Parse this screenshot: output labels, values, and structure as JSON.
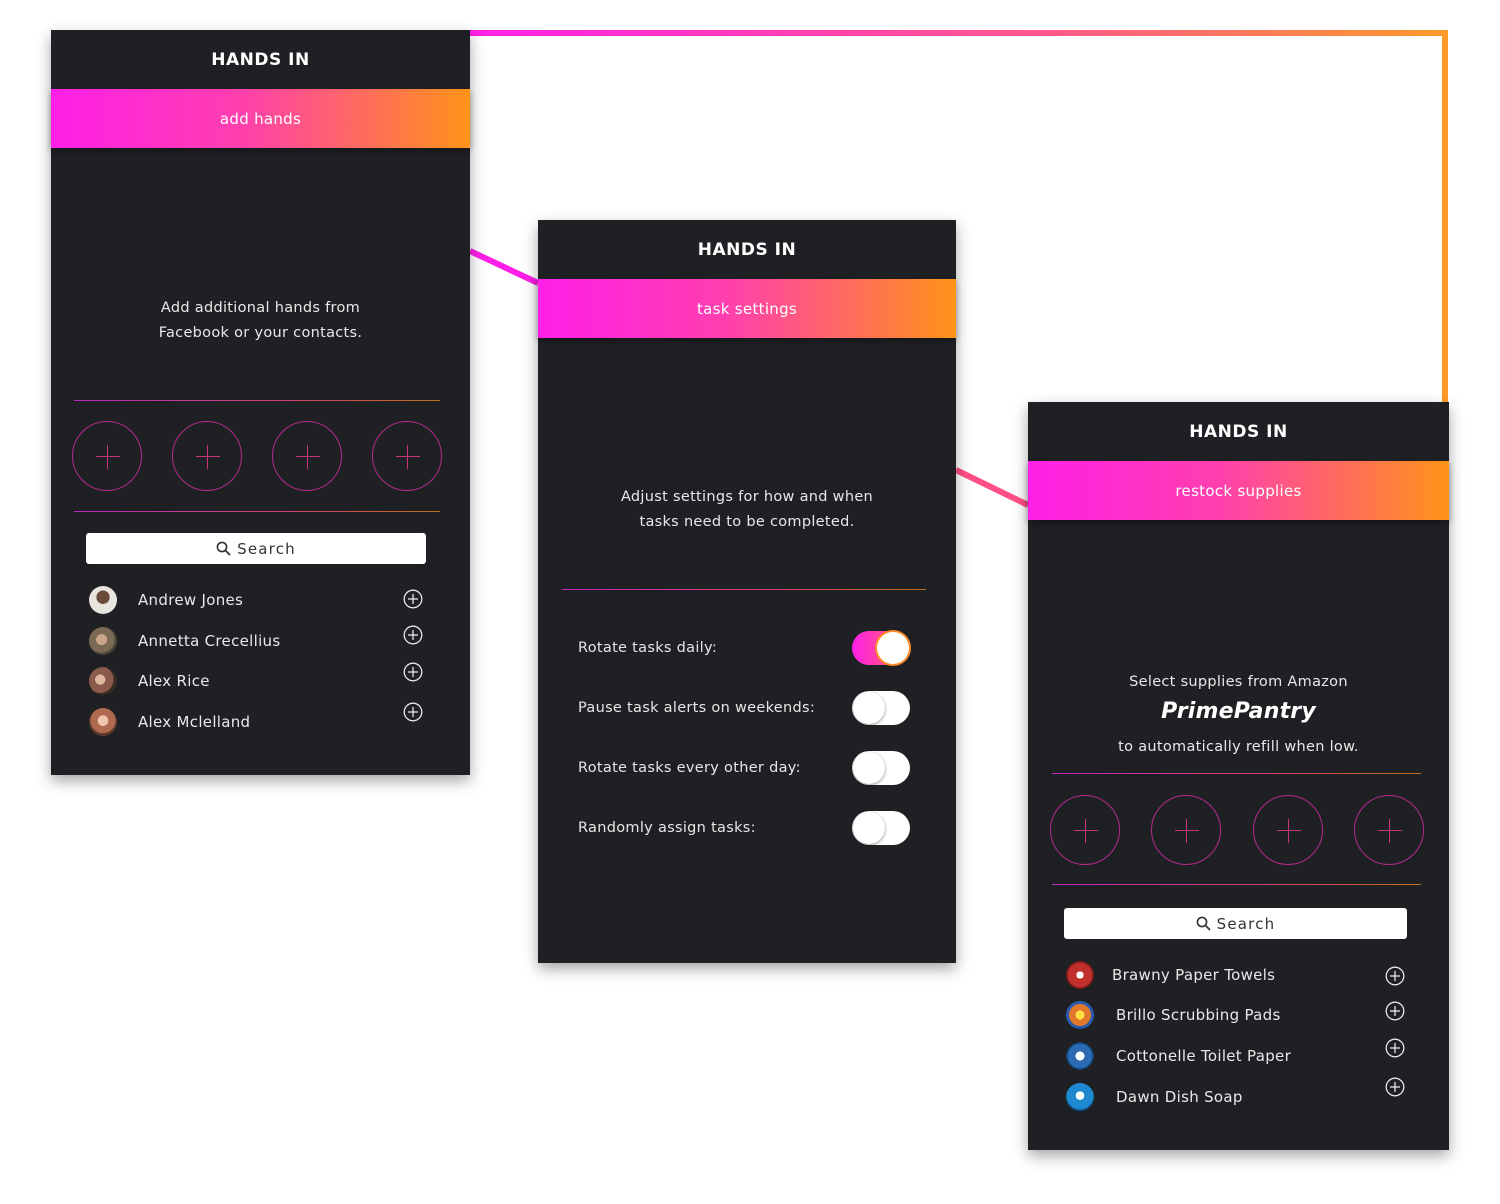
{
  "app": {
    "title": "HANDS IN"
  },
  "screen_add_hands": {
    "banner": "add hands",
    "description_line1": "Add additional hands from",
    "description_line2": "Facebook or your contacts.",
    "search_label": "Search",
    "contacts": [
      {
        "name": "Andrew Jones",
        "avatar_color": "#d9d4cf"
      },
      {
        "name": "Annetta Crecellius",
        "avatar_color": "#7a6a55"
      },
      {
        "name": "Alex Rice",
        "avatar_color": "#8a5a4a"
      },
      {
        "name": "Alex Mclelland",
        "avatar_color": "#b06a50"
      }
    ]
  },
  "screen_task_settings": {
    "banner": "task settings",
    "description_line1": "Adjust settings for how and when",
    "description_line2": "tasks need to be completed.",
    "settings": [
      {
        "label": "Rotate tasks daily:",
        "enabled": true
      },
      {
        "label": "Pause task alerts on weekends:",
        "enabled": false
      },
      {
        "label": "Rotate tasks every other day:",
        "enabled": false
      },
      {
        "label": "Randomly assign tasks:",
        "enabled": false
      }
    ]
  },
  "screen_restock": {
    "banner": "restock supplies",
    "description_line1": "Select supplies from Amazon",
    "brand": "PrimePantry",
    "description_line2": "to automatically refill when low.",
    "search_label": "Search",
    "products": [
      {
        "name": "Brawny Paper Towels",
        "icon_color": "#c0302a"
      },
      {
        "name": "Brillo Scrubbing Pads",
        "icon_color": "#e07a2a"
      },
      {
        "name": "Cottonelle Toilet Paper",
        "icon_color": "#2a6ab0"
      },
      {
        "name": "Dawn Dish Soap",
        "icon_color": "#1e88d0"
      }
    ]
  },
  "colors": {
    "background": "#1f2024",
    "gradient_start": "#ff1fe8",
    "gradient_end": "#ff9318"
  }
}
